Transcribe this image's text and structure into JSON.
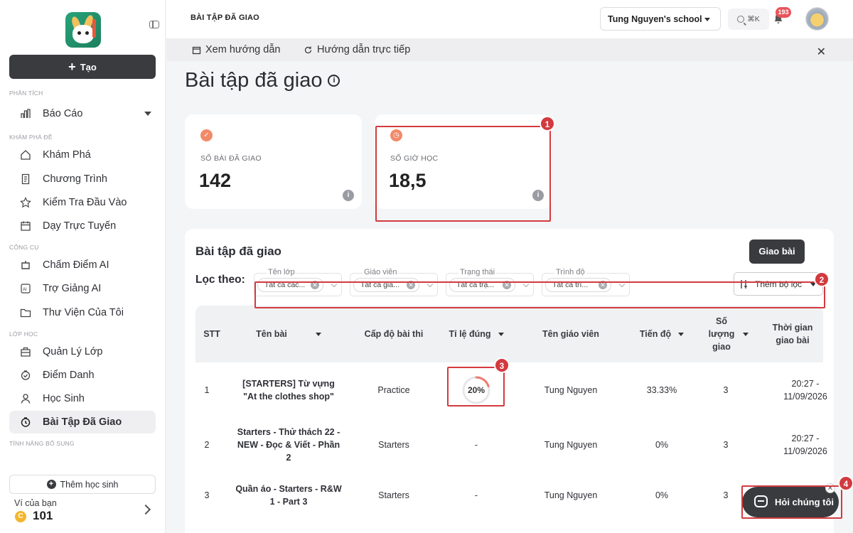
{
  "sidebar": {
    "create_label": "Tạo",
    "sections": {
      "analysis": "PHÂN TÍCH",
      "explore": "KHÁM PHÁ ĐỀ",
      "tools": "CÔNG CỤ",
      "classes": "LỚP HỌC",
      "extra": "TÍNH NĂNG BỔ SUNG"
    },
    "items": {
      "reports": "Báo Cáo",
      "explore": "Khám Phá",
      "program": "Chương Trình",
      "placement": "Kiểm Tra Đầu Vào",
      "online": "Dạy Trực Tuyến",
      "ai_grading": "Chấm Điểm AI",
      "ai_assistant": "Trợ Giảng AI",
      "library": "Thư Viện Của Tôi",
      "class_mgmt": "Quản Lý Lớp",
      "attendance": "Điểm Danh",
      "students": "Học Sinh",
      "assigned": "Bài Tập Đã Giao"
    },
    "add_student": "Thêm học sinh",
    "wallet_label": "Ví của bạn",
    "wallet_value": "101"
  },
  "topbar": {
    "breadcrumb": "BÀI TẬP ĐÃ GIAO",
    "school": "Tung Nguyen's school",
    "search_shortcut": "⌘K",
    "notifications": "193"
  },
  "helpbar": {
    "guide": "Xem hướng dẫn",
    "live_guide": "Hướng dẫn trực tiếp"
  },
  "page": {
    "title": "Bài tập đã giao"
  },
  "stats": {
    "assigned_label": "SỐ BÀI ĐÃ GIAO",
    "assigned_value": "142",
    "hours_label": "SỐ GIỜ HỌC",
    "hours_value": "18,5"
  },
  "panel": {
    "title": "Bài tập đã giao",
    "assign_button": "Giao bài",
    "filter_label": "Lọc theo:",
    "filters": [
      {
        "label": "Tên lớp",
        "chip": "Tất cả các..."
      },
      {
        "label": "Giáo viên",
        "chip": "Tất cả giá..."
      },
      {
        "label": "Trạng thái",
        "chip": "Tất cả trạ..."
      },
      {
        "label": "Trình độ",
        "chip": "Tất cả trì..."
      }
    ],
    "more_filter": "Thêm bộ lọc"
  },
  "table": {
    "headers": {
      "stt": "STT",
      "name": "Tên bài",
      "level": "Cấp độ bài thi",
      "rate": "Tỉ lệ đúng",
      "teacher": "Tên giáo viên",
      "progress": "Tiến độ",
      "count": "Số lượng giao",
      "time": "Thời gian giao bài"
    },
    "rows": [
      {
        "stt": "1",
        "name": "[STARTERS] Từ vựng \"At the clothes shop\"",
        "level": "Practice",
        "rate": "20%",
        "teacher": "Tung Nguyen",
        "progress": "33.33%",
        "count": "3",
        "time": "20:27 - 11/09/2026"
      },
      {
        "stt": "2",
        "name": "Starters - Thử thách 22 - NEW - Đọc & Viết - Phần 2",
        "level": "Starters",
        "rate": "-",
        "teacher": "Tung Nguyen",
        "progress": "0%",
        "count": "3",
        "time": "20:27 - 11/09/2026"
      },
      {
        "stt": "3",
        "name": "Quần áo - Starters - R&W 1 - Part 3",
        "level": "Starters",
        "rate": "-",
        "teacher": "Tung Nguyen",
        "progress": "0%",
        "count": "3",
        "time": ""
      }
    ],
    "rate_fraction": 0.2
  },
  "annotations": [
    "1",
    "2",
    "3",
    "4"
  ],
  "chat": {
    "label": "Hỏi chúng tôi"
  },
  "colors": {
    "primary_dark": "#3a3b3f",
    "highlight": "#d33a3f",
    "stat_icon": "#f28a68"
  }
}
